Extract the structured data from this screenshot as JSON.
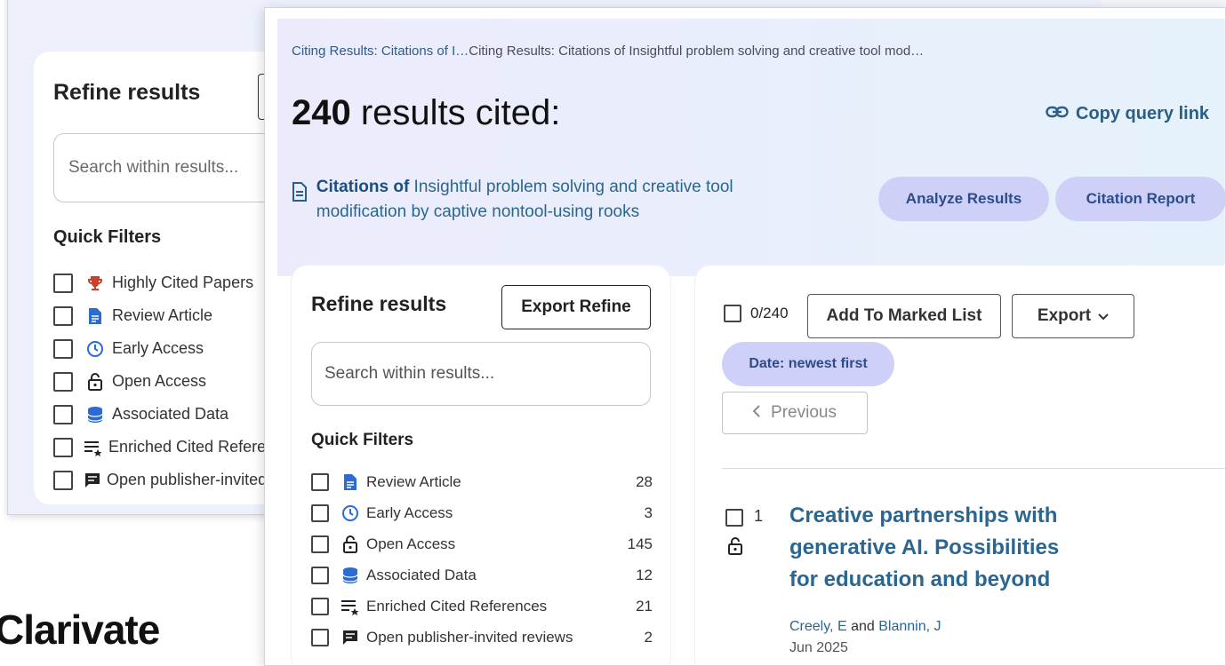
{
  "background_window": {
    "refine_title": "Refine results",
    "search_placeholder": "Search within results...",
    "quick_filters_title": "Quick Filters",
    "filters": [
      {
        "label": "Highly Cited Papers",
        "icon": "trophy-icon"
      },
      {
        "label": "Review Article",
        "icon": "document-icon"
      },
      {
        "label": "Early Access",
        "icon": "clock-icon"
      },
      {
        "label": "Open Access",
        "icon": "lock-icon"
      },
      {
        "label": "Associated Data",
        "icon": "database-icon"
      },
      {
        "label": "Enriched Cited References",
        "icon": "enriched-list-icon"
      },
      {
        "label": "Open publisher-invited reviews",
        "icon": "comment-icon"
      }
    ]
  },
  "logo": {
    "text": "Clarivate"
  },
  "header": {
    "breadcrumb_short": "Citing Results: Citations of I…",
    "breadcrumb_full": "Citing Results: Citations of Insightful problem solving and creative tool mod…",
    "count": "240",
    "count_suffix": " results cited:",
    "copy_link": "Copy query link",
    "citation_prefix": "Citations of",
    "citation_title": " Insightful problem solving and creative tool modification by captive nontool-using rooks",
    "analyze_button": "Analyze Results",
    "citation_report_button": "Citation Report"
  },
  "refine": {
    "title": "Refine results",
    "export_button": "Export Refine",
    "search_placeholder": "Search within results...",
    "quick_filters_title": "Quick Filters",
    "filters": [
      {
        "label": "Review Article",
        "count": "28",
        "icon": "document-icon"
      },
      {
        "label": "Early Access",
        "count": "3",
        "icon": "clock-icon"
      },
      {
        "label": "Open Access",
        "count": "145",
        "icon": "lock-icon"
      },
      {
        "label": "Associated Data",
        "count": "12",
        "icon": "database-icon"
      },
      {
        "label": "Enriched Cited References",
        "count": "21",
        "icon": "enriched-list-icon"
      },
      {
        "label": "Open publisher-invited reviews",
        "count": "2",
        "icon": "comment-icon"
      }
    ]
  },
  "results": {
    "selected": "0/240",
    "add_to_marked": "Add To Marked List",
    "export": "Export",
    "sort": "Date: newest first",
    "previous": "Previous",
    "records": [
      {
        "number": "1",
        "title": "Creative partnerships with generative AI. Possibilities for education and beyond",
        "author1": "Creely, E",
        "and": "and",
        "author2": "Blannin, J",
        "date": "Jun 2025"
      }
    ]
  },
  "colors": {
    "accent_link": "#2b6690",
    "pill_bg": "#cfd0f8",
    "pill_text": "#2c4c8a",
    "trophy": "#c8412a",
    "icon_blue": "#2c6bd1"
  }
}
